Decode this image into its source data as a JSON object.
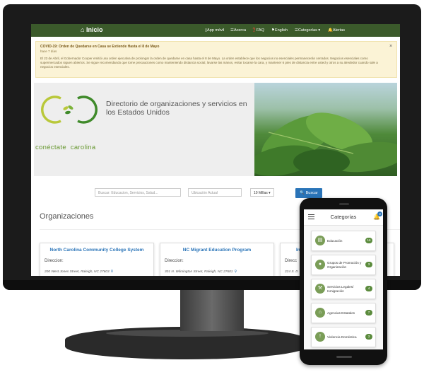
{
  "navbar": {
    "home": "Inicio",
    "items": [
      "App móvil",
      "Acerca",
      "FAQ",
      "English",
      "Categorías",
      "Alertas"
    ]
  },
  "alert": {
    "title": "COVID-19: Orden de Quedarse en Casa se Extiende Hasta el 8 de Mayo",
    "time": "hace 7 días",
    "body": "El 23 de Abril, el Gobernador Cooper emitió una orden ejecutiva de prolongar la orden de quedarse en casa hasta el 8 de Mayo. La orden establece que los negocios no esenciales permanecerán cerrados. Negocios esenciales como supermercados siguen abiertos. Se sigue recomendando que tome precauciones como manteniendo distancia social, lavarse las manos, evitar tocarse la cara, y mantener 6 pies de distancia entre usted y otros a su alrededor cuando sale a negocios esenciales.",
    "close": "×"
  },
  "hero": {
    "title": "Directorio de organizaciones y servicios en los Estados Unidos",
    "brand_a": "conéctate",
    "brand_b": "carolina"
  },
  "search": {
    "query_placeholder": "Buscar: Educacion, Servicios, Salud...",
    "location_placeholder": "Ubicación Actual",
    "distance": "10 Millas",
    "button": "Buscar"
  },
  "organizations": {
    "title": "Organizaciones",
    "cards": [
      {
        "name": "North Carolina Community College System",
        "label": "Direccion:",
        "address": "200 West Jones Street, Raleigh, NC 27603"
      },
      {
        "name": "NC Migrant Education Program",
        "label": "Direccion:",
        "address": "301 N. Wilmington Street, Raleigh, NC 27601"
      },
      {
        "name": "In",
        "label": "Direcc",
        "address": "224 S. D"
      }
    ]
  },
  "mobile": {
    "title": "Categorías",
    "notification_count": "3",
    "categories": [
      {
        "label": "Educación",
        "count": "16",
        "icon": "book-icon"
      },
      {
        "label": "Grupos de Promoción y Organización",
        "count": "3",
        "icon": "chat-icon"
      },
      {
        "label": "Servicios Legales/ Inmigración",
        "count": "4",
        "icon": "gavel-icon"
      },
      {
        "label": "Agencias Estatales",
        "count": "7",
        "icon": "building-icon"
      },
      {
        "label": "Violencia Doméstica",
        "count": "3",
        "icon": "alert-icon"
      }
    ]
  }
}
